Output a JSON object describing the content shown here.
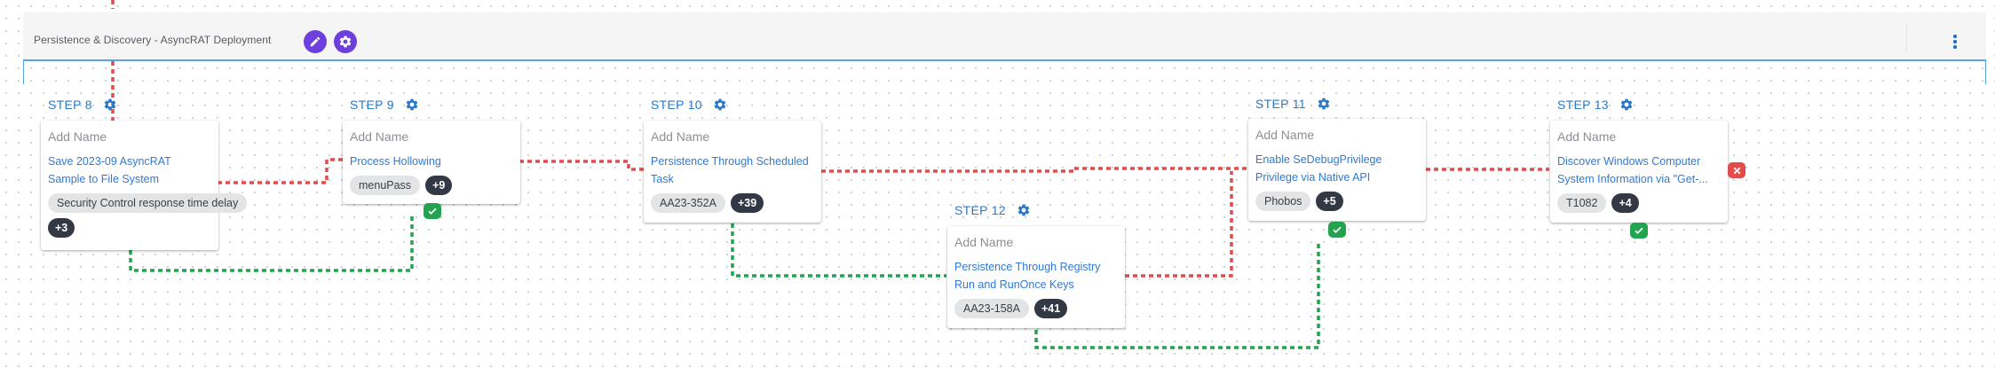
{
  "header": {
    "title": "Persistence & Discovery - AsyncRAT Deployment",
    "edit_icon": "pencil-icon",
    "settings_icon": "gear-icon",
    "menu_icon": "more-vert-icon",
    "accent_color": "#6d3fdc",
    "border_color": "#59a3e8"
  },
  "colors": {
    "success_path": "#22a34f",
    "failure_path": "#e24c4b",
    "link": "#2f7ad6",
    "step_label": "#2a78c8"
  },
  "steps": [
    {
      "label": "STEP 8",
      "name_placeholder": "Add Name",
      "title": "Save 2023-09 AsyncRAT Sample to File System",
      "tags": [
        "Security Control response time delay"
      ],
      "more": "+3",
      "status": "none"
    },
    {
      "label": "STEP 9",
      "name_placeholder": "Add Name",
      "title": "Process Hollowing",
      "tags": [
        "menuPass"
      ],
      "more": "+9",
      "status": "success"
    },
    {
      "label": "STEP 10",
      "name_placeholder": "Add Name",
      "title": "Persistence Through Scheduled Task",
      "tags": [
        "AA23-352A"
      ],
      "more": "+39",
      "status": "none"
    },
    {
      "label": "STEP 12",
      "name_placeholder": "Add Name",
      "title": "Persistence Through Registry Run and RunOnce Keys",
      "tags": [
        "AA23-158A"
      ],
      "more": "+41",
      "status": "none"
    },
    {
      "label": "STEP 11",
      "name_placeholder": "Add Name",
      "title": "Enable SeDebugPrivilege Privilege via Native API",
      "tags": [
        "Phobos"
      ],
      "more": "+5",
      "status": "success"
    },
    {
      "label": "STEP 13",
      "name_placeholder": "Add Name",
      "title": "Discover Windows Computer System Information via \"Get-...",
      "tags": [
        "T1082"
      ],
      "more": "+4",
      "status": "success"
    }
  ]
}
